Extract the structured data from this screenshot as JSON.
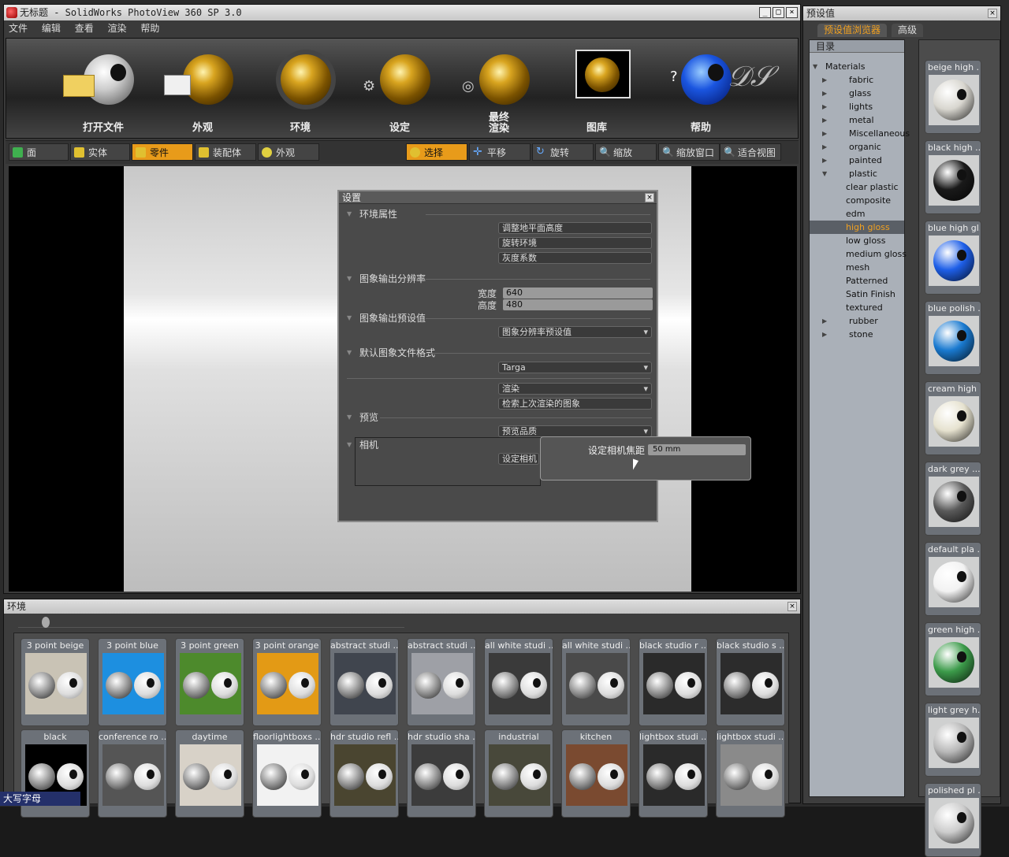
{
  "window": {
    "title": "无标题 - SolidWorks PhotoView 360 SP 3.0",
    "min": "_",
    "max": "□",
    "close": "×"
  },
  "menu": [
    "文件",
    "编辑",
    "查看",
    "渲染",
    "帮助"
  ],
  "toolbar": [
    {
      "label": "打开文件",
      "ball": "silver",
      "icon": "folder-icon"
    },
    {
      "label": "外观",
      "ball": "gold",
      "icon": "palette-icon"
    },
    {
      "label": "环境",
      "ball": "gold",
      "icon": "environment-icon"
    },
    {
      "label": "设定",
      "ball": "gold",
      "icon": "gear-icon"
    },
    {
      "label": "最终\n渲染",
      "ball": "gold",
      "icon": "camera-icon"
    },
    {
      "label": "图库",
      "ball": "gold",
      "icon": "gallery-icon"
    },
    {
      "label": "帮助",
      "ball": "blue",
      "icon": "help-icon"
    }
  ],
  "selection_modes": [
    {
      "label": "面",
      "active": false,
      "color": "#3fb04f"
    },
    {
      "label": "实体",
      "active": false,
      "color": "#e0c030"
    },
    {
      "label": "零件",
      "active": true,
      "color": "#e0c030"
    },
    {
      "label": "装配体",
      "active": false,
      "color": "#e0c030"
    },
    {
      "label": "外观",
      "active": false,
      "color": "#e0d040"
    }
  ],
  "view_tools": [
    {
      "label": "选择",
      "active": true
    },
    {
      "label": "平移",
      "active": false
    },
    {
      "label": "旋转",
      "active": false
    },
    {
      "label": "缩放",
      "active": false
    },
    {
      "label": "缩放窗口",
      "active": false
    },
    {
      "label": "适合视图",
      "active": false
    }
  ],
  "settings": {
    "title": "设置",
    "env_section": "环境属性",
    "env_buttons": [
      "调整地平面高度",
      "旋转环境",
      "灰度系数"
    ],
    "res_section": "图象输出分辨率",
    "width_label": "宽度",
    "width_value": "640",
    "height_label": "高度",
    "height_value": "480",
    "preset_section": "图象输出预设值",
    "preset_value": "图象分辨率预设值",
    "format_section": "默认图象文件格式",
    "format_value": "Targa",
    "render_value": "渲染",
    "retrieve_label": "检索上次渲染的图象",
    "preview_section": "预览",
    "preview_value": "预览品质",
    "camera_section": "相机",
    "camera_button": "设定相机",
    "focal_label": "设定相机焦距",
    "focal_value": "50 mm"
  },
  "env_panel": {
    "title": "环境",
    "items": [
      {
        "label": "3 point beige",
        "bg": "#c9c3b5"
      },
      {
        "label": "3 point blue",
        "bg": "#1d8fe0"
      },
      {
        "label": "3 point green",
        "bg": "#4d8a2c"
      },
      {
        "label": "3 point orange",
        "bg": "#e39a15"
      },
      {
        "label": "abstract studi ...",
        "bg": "#40454e"
      },
      {
        "label": "abstract studi ...",
        "bg": "#9ea0a6"
      },
      {
        "label": "all white studi ...",
        "bg": "#3a3a3a"
      },
      {
        "label": "all white studi ...",
        "bg": "#4a4a4a"
      },
      {
        "label": "black studio r ...",
        "bg": "#2a2a2a"
      },
      {
        "label": "black studio s ...",
        "bg": "#2c2c2c"
      },
      {
        "label": "black",
        "bg": "#000000"
      },
      {
        "label": "conference ro ...",
        "bg": "#555555"
      },
      {
        "label": "daytime",
        "bg": "#d8d2c8"
      },
      {
        "label": "floorlightboxs ...",
        "bg": "#f2f2f2"
      },
      {
        "label": "hdr studio refl ...",
        "bg": "#4a4530"
      },
      {
        "label": "hdr studio sha ...",
        "bg": "#3c3c3c"
      },
      {
        "label": "industrial",
        "bg": "#48483a"
      },
      {
        "label": "kitchen",
        "bg": "#7a4a30"
      },
      {
        "label": "lightbox studi ...",
        "bg": "#2a2a2a"
      },
      {
        "label": "lightbox studi ...",
        "bg": "#8a8a8a"
      }
    ]
  },
  "status": "大写字母",
  "presets": {
    "title": "预设值",
    "tabs": [
      "预设值浏览器",
      "高级"
    ],
    "tree_header": "目录",
    "tree": [
      {
        "label": "Materials",
        "level": 0,
        "expanded": true
      },
      {
        "label": "fabric",
        "level": 1
      },
      {
        "label": "glass",
        "level": 1
      },
      {
        "label": "lights",
        "level": 1
      },
      {
        "label": "metal",
        "level": 1
      },
      {
        "label": "Miscellaneous",
        "level": 1
      },
      {
        "label": "organic",
        "level": 1
      },
      {
        "label": "painted",
        "level": 1
      },
      {
        "label": "plastic",
        "level": 1,
        "expanded": true
      },
      {
        "label": "clear plastic",
        "level": 2
      },
      {
        "label": "composite",
        "level": 2
      },
      {
        "label": "edm",
        "level": 2
      },
      {
        "label": "high gloss",
        "level": 2,
        "selected": true
      },
      {
        "label": "low gloss",
        "level": 2
      },
      {
        "label": "medium gloss",
        "level": 2
      },
      {
        "label": "mesh",
        "level": 2
      },
      {
        "label": "Patterned",
        "level": 2
      },
      {
        "label": "Satin Finish",
        "level": 2
      },
      {
        "label": "textured",
        "level": 2
      },
      {
        "label": "rubber",
        "level": 1
      },
      {
        "label": "stone",
        "level": 1
      }
    ],
    "materials": [
      {
        "label": "beige high ...",
        "color": "#d8d6cf"
      },
      {
        "label": "black high ...",
        "color": "#1a1a1a"
      },
      {
        "label": "blue high gl...",
        "color": "#1e5fe8"
      },
      {
        "label": "blue polish ...",
        "color": "#1a7ad0"
      },
      {
        "label": "cream high ...",
        "color": "#e6e2cf"
      },
      {
        "label": "dark grey ...",
        "color": "#5a5a5a"
      },
      {
        "label": "default pla ...",
        "color": "#f2f2f2"
      },
      {
        "label": "green high ...",
        "color": "#3c9b4a"
      },
      {
        "label": "light grey h...",
        "color": "#b8b8b8"
      },
      {
        "label": "polished pl ...",
        "color": "#cccccc"
      }
    ]
  }
}
